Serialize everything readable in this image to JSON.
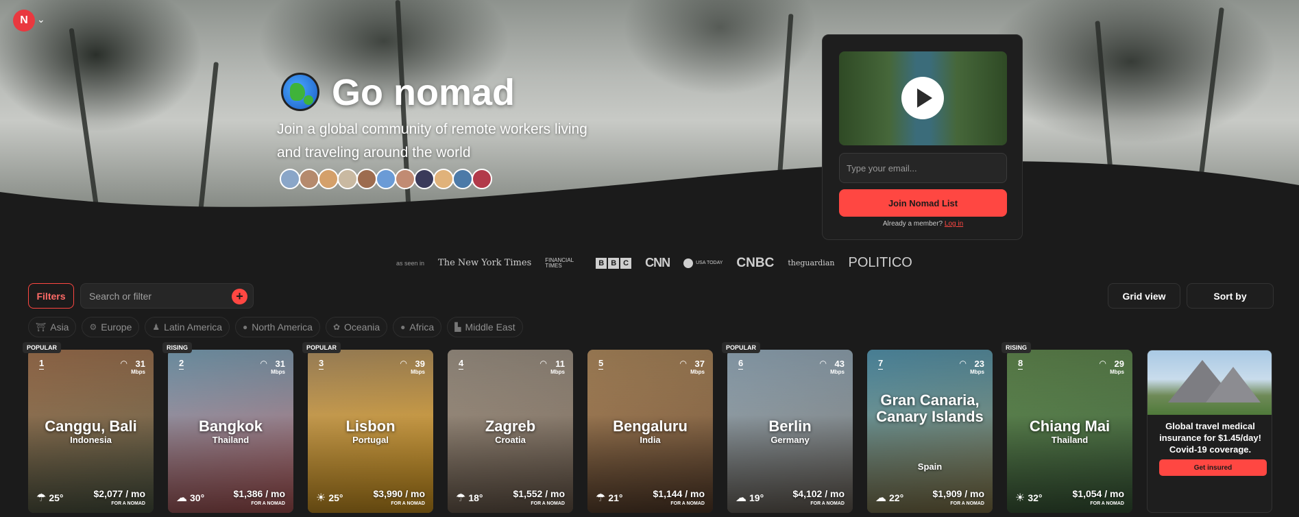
{
  "hero": {
    "title": "Go nomad",
    "subtitle": "Join a global community of remote workers living and traveling around the world"
  },
  "signup": {
    "email_placeholder": "Type your email...",
    "join_label": "Join Nomad List",
    "member_text": "Already a member?",
    "login_label": "Log in"
  },
  "press": {
    "label": "as seen in",
    "nyt": "The New York Times",
    "ft": "FINANCIAL TIMES",
    "bbc": [
      "B",
      "B",
      "C"
    ],
    "cnn": "CNN",
    "usatoday": "USA TODAY",
    "cnbc": "CNBC",
    "guardian": "theguardian",
    "politico": "POLITICO"
  },
  "toolbar": {
    "filters_label": "Filters",
    "search_placeholder": "Search or filter",
    "plus_label": "+",
    "grid_view_label": "Grid view",
    "sort_by_label": "Sort by"
  },
  "regions": [
    {
      "label": "Asia",
      "icon": "⛩"
    },
    {
      "label": "Europe",
      "icon": "⚙"
    },
    {
      "label": "Latin America",
      "icon": "♟"
    },
    {
      "label": "North America",
      "icon": "●"
    },
    {
      "label": "Oceania",
      "icon": "✿"
    },
    {
      "label": "Africa",
      "icon": "●"
    },
    {
      "label": "Middle East",
      "icon": "▙"
    }
  ],
  "cards": [
    {
      "rank": "1",
      "badge": "POPULAR",
      "city": "Canggu, Bali",
      "country": "Indonesia",
      "wifi": "31",
      "wifi_unit": "Mbps",
      "temp": "25°",
      "weather_icon": "☂",
      "price": "$2,077 / mo",
      "price_sub": "FOR A NOMAD",
      "color1": "#b5815a",
      "color2": "#4f5a46"
    },
    {
      "rank": "2",
      "badge": "RISING",
      "city": "Bangkok",
      "country": "Thailand",
      "wifi": "31",
      "wifi_unit": "Mbps",
      "temp": "30°",
      "weather_icon": "☁",
      "price": "$1,386 / mo",
      "price_sub": "FOR A NOMAD",
      "color1": "#8bb7cf",
      "color2": "#b35757"
    },
    {
      "rank": "3",
      "badge": "POPULAR",
      "city": "Lisbon",
      "country": "Portugal",
      "wifi": "39",
      "wifi_unit": "Mbps",
      "temp": "25°",
      "weather_icon": "☀",
      "price": "$3,990 / mo",
      "price_sub": "FOR A NOMAD",
      "color1": "#c6a36f",
      "color2": "#d89b1e"
    },
    {
      "rank": "4",
      "badge": "",
      "city": "Zagreb",
      "country": "Croatia",
      "wifi": "11",
      "wifi_unit": "Mbps",
      "temp": "18°",
      "weather_icon": "☂",
      "price": "$1,552 / mo",
      "price_sub": "FOR A NOMAD",
      "color1": "#b2a697",
      "color2": "#6c5b4c"
    },
    {
      "rank": "5",
      "badge": "",
      "city": "Bengaluru",
      "country": "India",
      "wifi": "37",
      "wifi_unit": "Mbps",
      "temp": "21°",
      "weather_icon": "☂",
      "price": "$1,144 / mo",
      "price_sub": "FOR A NOMAD",
      "color1": "#c49b6a",
      "color2": "#5a3f2c"
    },
    {
      "rank": "6",
      "badge": "POPULAR",
      "city": "Berlin",
      "country": "Germany",
      "wifi": "43",
      "wifi_unit": "Mbps",
      "temp": "19°",
      "weather_icon": "☁",
      "price": "$4,102 / mo",
      "price_sub": "FOR A NOMAD",
      "color1": "#a9c2d4",
      "color2": "#6b6258"
    },
    {
      "rank": "7",
      "badge": "",
      "city": "Gran Canaria, Canary Islands",
      "country": "Spain",
      "wifi": "23",
      "wifi_unit": "Mbps",
      "temp": "22°",
      "weather_icon": "☁",
      "price": "$1,909 / mo",
      "price_sub": "FOR A NOMAD",
      "color1": "#5fa7c4",
      "color2": "#8a7a4a"
    },
    {
      "rank": "8",
      "badge": "RISING",
      "city": "Chiang Mai",
      "country": "Thailand",
      "wifi": "29",
      "wifi_unit": "Mbps",
      "temp": "32°",
      "weather_icon": "☀",
      "price": "$1,054 / mo",
      "price_sub": "FOR A NOMAD",
      "color1": "#6e9a5a",
      "color2": "#3a5a3a"
    }
  ],
  "ad": {
    "text": "Global travel medical insurance for $1.45/day! Covid-19 coverage.",
    "cta": "Get insured"
  }
}
